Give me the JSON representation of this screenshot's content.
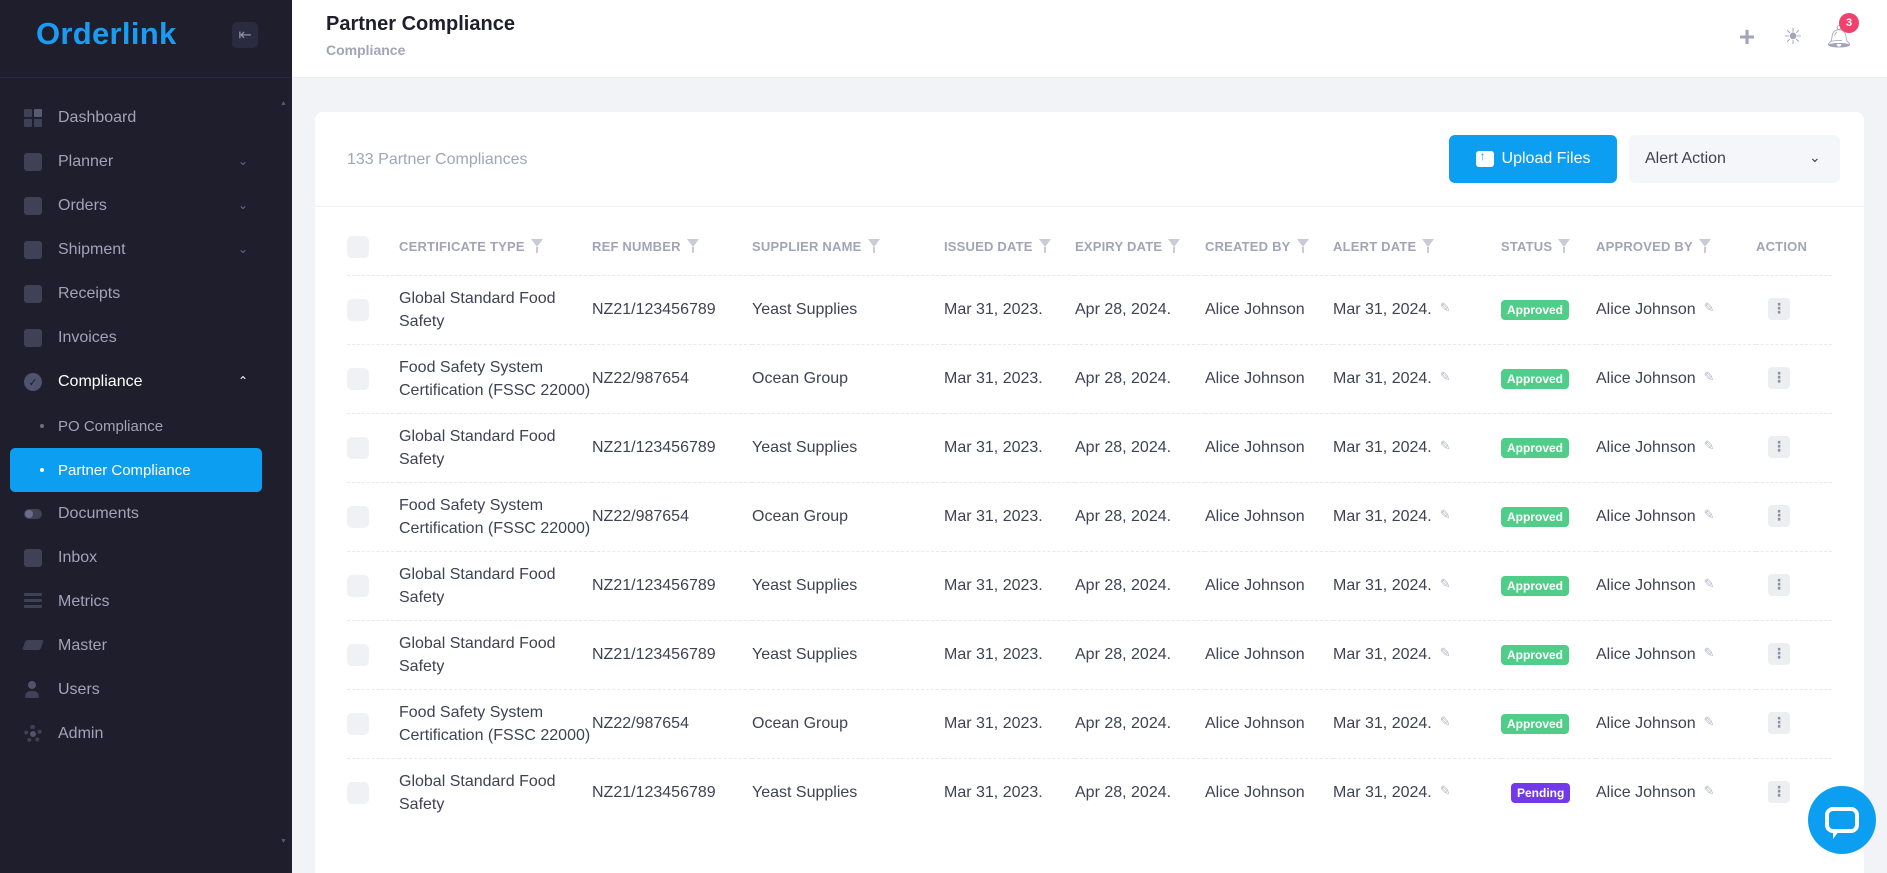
{
  "brand": "Orderlink",
  "sidebar": {
    "items": [
      {
        "label": "Dashboard",
        "icon": "dashboard-icon"
      },
      {
        "label": "Planner",
        "icon": "planner-icon",
        "has_children": true
      },
      {
        "label": "Orders",
        "icon": "cart-icon",
        "has_children": true
      },
      {
        "label": "Shipment",
        "icon": "truck-icon",
        "has_children": true
      },
      {
        "label": "Receipts",
        "icon": "receipt-icon"
      },
      {
        "label": "Invoices",
        "icon": "invoice-icon"
      },
      {
        "label": "Compliance",
        "icon": "check-badge-icon",
        "expanded": true,
        "children": [
          {
            "label": "PO Compliance"
          },
          {
            "label": "Partner Compliance",
            "active": true
          }
        ]
      },
      {
        "label": "Documents",
        "icon": "toggle-icon"
      },
      {
        "label": "Inbox",
        "icon": "inbox-icon"
      },
      {
        "label": "Metrics",
        "icon": "metrics-icon"
      },
      {
        "label": "Master",
        "icon": "layers-icon"
      },
      {
        "label": "Users",
        "icon": "users-icon"
      },
      {
        "label": "Admin",
        "icon": "gear-icon"
      }
    ]
  },
  "header": {
    "title": "Partner Compliance",
    "breadcrumb": "Compliance",
    "notification_count": "3"
  },
  "card": {
    "count_label": "133 Partner Compliances",
    "upload_label": "Upload Files",
    "alert_action_label": "Alert Action"
  },
  "table": {
    "columns": [
      "Certificate Type",
      "Ref Number",
      "Supplier Name",
      "Issued Date",
      "Expiry Date",
      "Created By",
      "Alert Date",
      "Status",
      "Approved By",
      "Action"
    ],
    "rows": [
      {
        "cert": "Global Standard Food Safety",
        "ref": "NZ21/123456789",
        "supplier": "Yeast Supplies",
        "issued": "Mar 31, 2023.",
        "expiry": "Apr 28, 2024.",
        "created": "Alice Johnson",
        "alert": "Mar 31, 2024.",
        "status": "Approved",
        "approved": "Alice Johnson"
      },
      {
        "cert": "Food Safety System Certification (FSSC 22000)",
        "ref": "NZ22/987654",
        "supplier": "Ocean Group",
        "issued": "Mar 31, 2023.",
        "expiry": "Apr 28, 2024.",
        "created": "Alice Johnson",
        "alert": "Mar 31, 2024.",
        "status": "Approved",
        "approved": "Alice Johnson"
      },
      {
        "cert": "Global Standard Food Safety",
        "ref": "NZ21/123456789",
        "supplier": "Yeast Supplies",
        "issued": "Mar 31, 2023.",
        "expiry": "Apr 28, 2024.",
        "created": "Alice Johnson",
        "alert": "Mar 31, 2024.",
        "status": "Approved",
        "approved": "Alice Johnson"
      },
      {
        "cert": "Food Safety System Certification (FSSC 22000)",
        "ref": "NZ22/987654",
        "supplier": "Ocean Group",
        "issued": "Mar 31, 2023.",
        "expiry": "Apr 28, 2024.",
        "created": "Alice Johnson",
        "alert": "Mar 31, 2024.",
        "status": "Approved",
        "approved": "Alice Johnson"
      },
      {
        "cert": "Global Standard Food Safety",
        "ref": "NZ21/123456789",
        "supplier": "Yeast Supplies",
        "issued": "Mar 31, 2023.",
        "expiry": "Apr 28, 2024.",
        "created": "Alice Johnson",
        "alert": "Mar 31, 2024.",
        "status": "Approved",
        "approved": "Alice Johnson"
      },
      {
        "cert": "Global Standard Food Safety",
        "ref": "NZ21/123456789",
        "supplier": "Yeast Supplies",
        "issued": "Mar 31, 2023.",
        "expiry": "Apr 28, 2024.",
        "created": "Alice Johnson",
        "alert": "Mar 31, 2024.",
        "status": "Approved",
        "approved": "Alice Johnson"
      },
      {
        "cert": "Food Safety System Certification (FSSC 22000)",
        "ref": "NZ22/987654",
        "supplier": "Ocean Group",
        "issued": "Mar 31, 2023.",
        "expiry": "Apr 28, 2024.",
        "created": "Alice Johnson",
        "alert": "Mar 31, 2024.",
        "status": "Approved",
        "approved": "Alice Johnson"
      },
      {
        "cert": "Global Standard Food Safety",
        "ref": "NZ21/123456789",
        "supplier": "Yeast Supplies",
        "issued": "Mar 31, 2023.",
        "expiry": "Apr 28, 2024.",
        "created": "Alice Johnson",
        "alert": "Mar 31, 2024.",
        "status": "Pending",
        "approved": "Alice Johnson"
      }
    ]
  },
  "colors": {
    "sidebar_bg": "#1e1e2d",
    "brand_blue": "#1b9cf2",
    "primary": "#0c9ef0",
    "approved": "#50cd89",
    "pending": "#7239ea",
    "badge": "#f1416c"
  }
}
